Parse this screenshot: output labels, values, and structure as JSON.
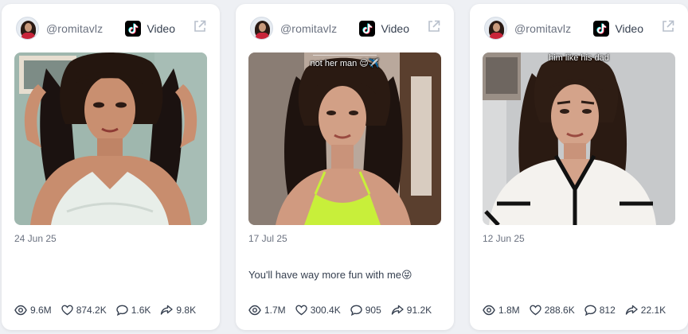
{
  "cards": [
    {
      "handle": "@romitavlz",
      "platform": "Video",
      "platform_icon": "tiktok-icon",
      "date": "24 Jun 25",
      "caption": "",
      "overlay_text": "",
      "stats": {
        "views": "9.6M",
        "likes": "874.2K",
        "comments": "1.6K",
        "shares": "9.8K"
      }
    },
    {
      "handle": "@romitavlz",
      "platform": "Video",
      "platform_icon": "tiktok-icon",
      "date": "17 Jul 25",
      "caption": "You'll have way more fun with me😝",
      "overlay_text": "not her man 😌✈️",
      "stats": {
        "views": "1.7M",
        "likes": "300.4K",
        "comments": "905",
        "shares": "91.2K"
      }
    },
    {
      "handle": "@romitavlz",
      "platform": "Video",
      "platform_icon": "tiktok-icon",
      "date": "12 Jun 25",
      "caption": "",
      "overlay_text": "him like his dad",
      "stats": {
        "views": "1.8M",
        "likes": "288.6K",
        "comments": "812",
        "shares": "22.1K"
      }
    }
  ],
  "colors": {
    "page_bg": "#eef0f4",
    "card_bg": "#ffffff",
    "muted_text": "#6b7280",
    "body_text": "#374151"
  }
}
